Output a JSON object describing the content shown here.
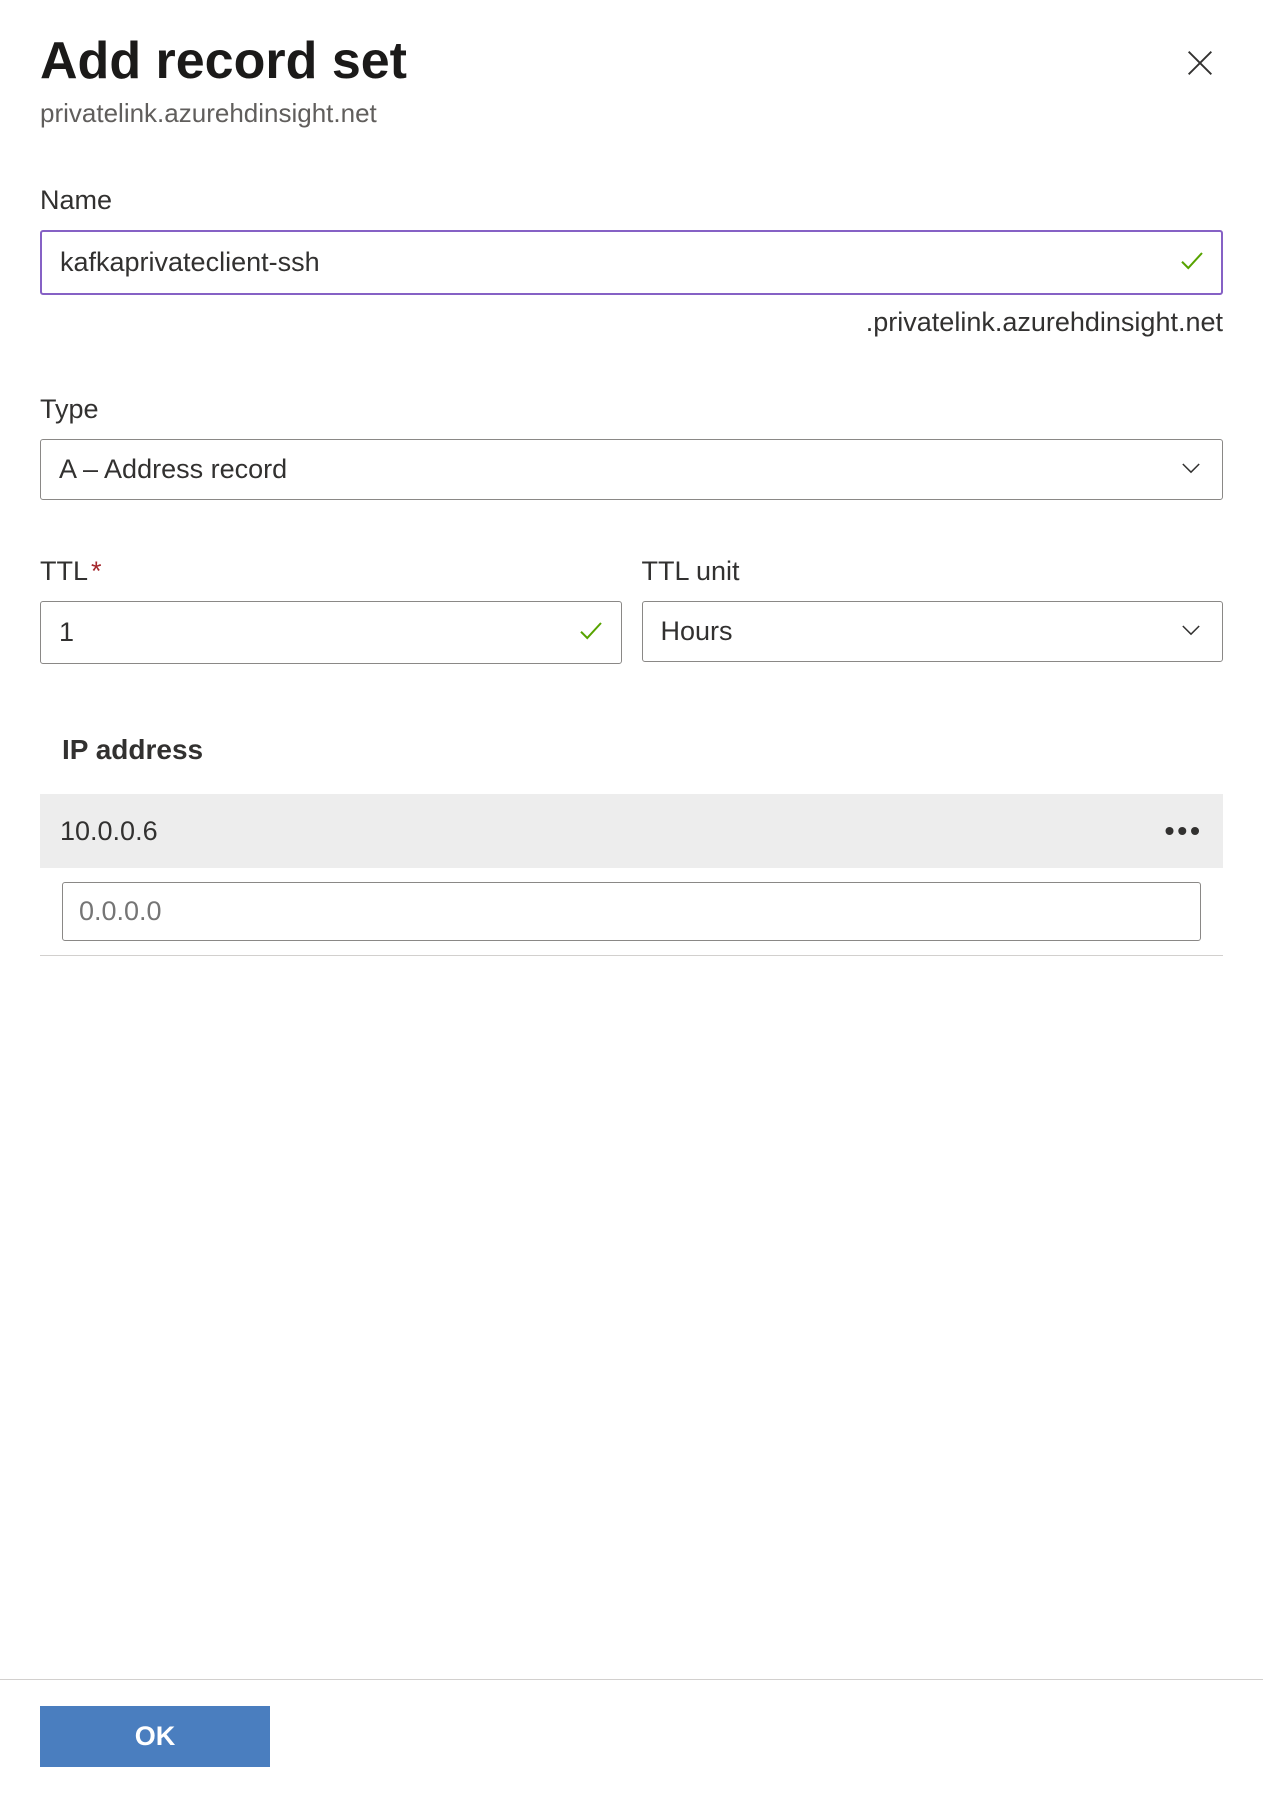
{
  "header": {
    "title": "Add record set",
    "subtitle": "privatelink.azurehdinsight.net"
  },
  "name_field": {
    "label": "Name",
    "value": "kafkaprivateclient-ssh",
    "suffix": ".privatelink.azurehdinsight.net"
  },
  "type_field": {
    "label": "Type",
    "selected": "A – Address record"
  },
  "ttl_field": {
    "label": "TTL",
    "value": "1"
  },
  "ttl_unit_field": {
    "label": "TTL unit",
    "selected": "Hours"
  },
  "ip_section": {
    "heading": "IP address",
    "rows": [
      {
        "value": "10.0.0.6"
      }
    ],
    "new_input_placeholder": "0.0.0.0"
  },
  "footer": {
    "ok_label": "OK"
  }
}
